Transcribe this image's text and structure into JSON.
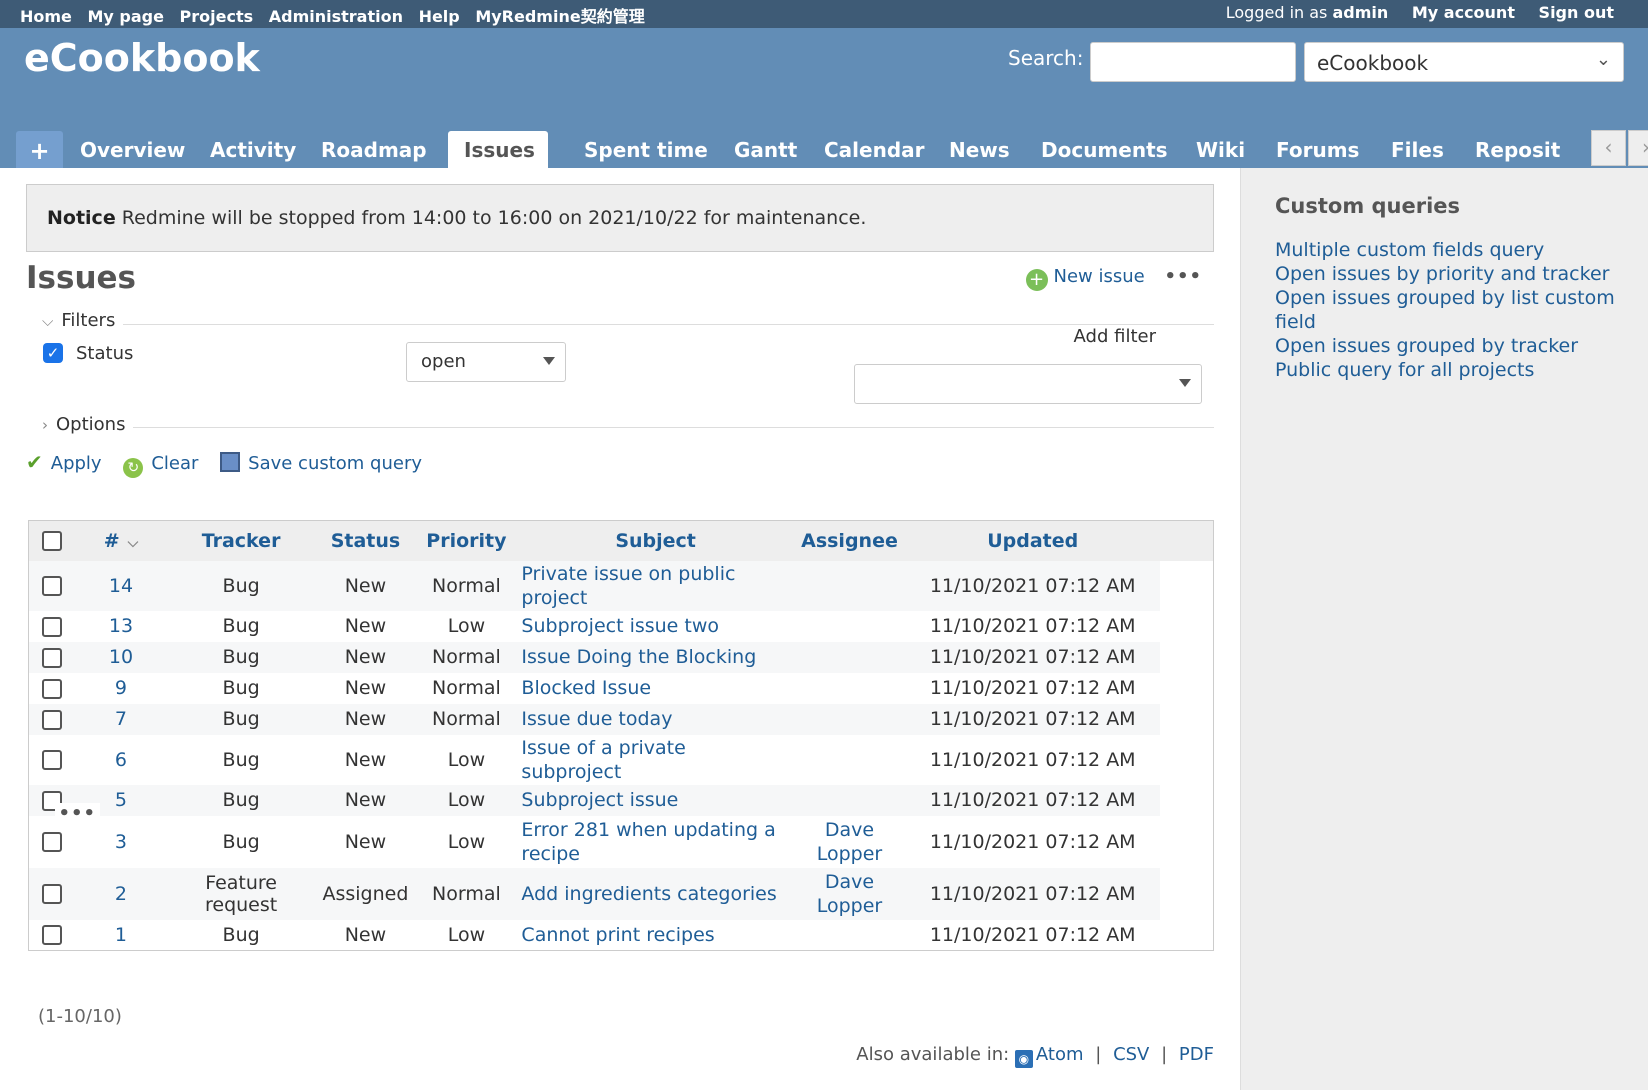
{
  "top_menu": {
    "items": [
      "Home",
      "My page",
      "Projects",
      "Administration",
      "Help",
      "MyRedmine契約管理"
    ],
    "logged_prefix": "Logged in as",
    "user": "admin",
    "my_account": "My account",
    "sign_out": "Sign out"
  },
  "header": {
    "title": "eCookbook",
    "search_label": "Search:",
    "search_value": "",
    "project_jump": "eCookbook"
  },
  "tabs": {
    "plus": "+",
    "items": [
      "Overview",
      "Activity",
      "Roadmap",
      "Issues",
      "Spent time",
      "Gantt",
      "Calendar",
      "News",
      "Documents",
      "Wiki",
      "Forums",
      "Files",
      "Reposit"
    ],
    "selected": "Issues",
    "scroll_left": "‹",
    "scroll_right": "›"
  },
  "flash": {
    "label": "Notice",
    "text": "Redmine will be stopped from 14:00 to 16:00 on 2021/10/22 for maintenance."
  },
  "page": {
    "title": "Issues",
    "new_issue": "New issue",
    "more": "•••"
  },
  "filters": {
    "legend": "Filters",
    "status_label": "Status",
    "status_checked": true,
    "status_value": "open",
    "add_filter_label": "Add filter",
    "add_filter_value": ""
  },
  "options": {
    "legend": "Options"
  },
  "buttons": {
    "apply": "Apply",
    "clear": "Clear",
    "save_query": "Save custom query"
  },
  "table": {
    "columns": [
      "#",
      "Tracker",
      "Status",
      "Priority",
      "Subject",
      "Assignee",
      "Updated"
    ],
    "rows": [
      {
        "id": "14",
        "tracker": "Bug",
        "status": "New",
        "priority": "Normal",
        "subject": "Private issue on public project",
        "assignee": "",
        "updated": "11/10/2021 07:12 AM"
      },
      {
        "id": "13",
        "tracker": "Bug",
        "status": "New",
        "priority": "Low",
        "subject": "Subproject issue two",
        "assignee": "",
        "updated": "11/10/2021 07:12 AM"
      },
      {
        "id": "10",
        "tracker": "Bug",
        "status": "New",
        "priority": "Normal",
        "subject": "Issue Doing the Blocking",
        "assignee": "",
        "updated": "11/10/2021 07:12 AM"
      },
      {
        "id": "9",
        "tracker": "Bug",
        "status": "New",
        "priority": "Normal",
        "subject": "Blocked Issue",
        "assignee": "",
        "updated": "11/10/2021 07:12 AM"
      },
      {
        "id": "7",
        "tracker": "Bug",
        "status": "New",
        "priority": "Normal",
        "subject": "Issue due today",
        "assignee": "",
        "updated": "11/10/2021 07:12 AM"
      },
      {
        "id": "6",
        "tracker": "Bug",
        "status": "New",
        "priority": "Low",
        "subject": "Issue of a private subproject",
        "assignee": "",
        "updated": "11/10/2021 07:12 AM"
      },
      {
        "id": "5",
        "tracker": "Bug",
        "status": "New",
        "priority": "Low",
        "subject": "Subproject issue",
        "assignee": "",
        "updated": "11/10/2021 07:12 AM"
      },
      {
        "id": "3",
        "tracker": "Bug",
        "status": "New",
        "priority": "Low",
        "subject": "Error 281 when updating a recipe",
        "assignee": "Dave Lopper",
        "updated": "11/10/2021 07:12 AM"
      },
      {
        "id": "2",
        "tracker": "Feature request",
        "status": "Assigned",
        "priority": "Normal",
        "subject": "Add ingredients categories",
        "assignee": "Dave Lopper",
        "updated": "11/10/2021 07:12 AM"
      },
      {
        "id": "1",
        "tracker": "Bug",
        "status": "New",
        "priority": "Low",
        "subject": "Cannot print recipes",
        "assignee": "",
        "updated": "11/10/2021 07:12 AM"
      }
    ],
    "row_menu": "•••"
  },
  "pagination": "(1-10/10)",
  "other_formats": {
    "label": "Also available in:",
    "atom": "Atom",
    "csv": "CSV",
    "pdf": "PDF",
    "separator": "|"
  },
  "sidebar": {
    "title": "Custom queries",
    "queries": [
      "Multiple custom fields query",
      "Open issues by priority and tracker",
      "Open issues grouped by list custom field",
      "Open issues grouped by tracker",
      "Public query for all projects"
    ]
  },
  "colors": {
    "top_menu_bg": "#3e5b76",
    "header_bg": "#628db6",
    "link": "#1f5d96",
    "sidebar_bg": "#eeeeee"
  }
}
